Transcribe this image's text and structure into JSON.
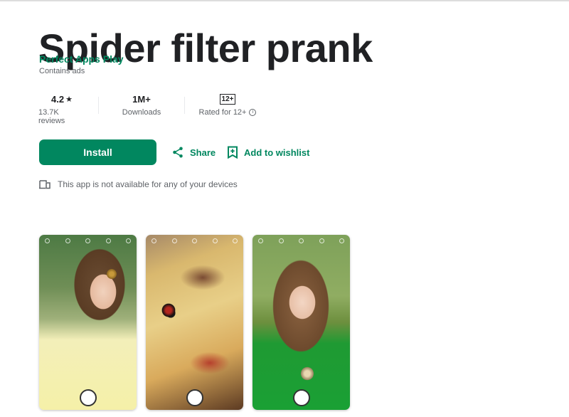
{
  "app": {
    "title": "Spider filter prank",
    "developer": "Perfect Apps Play",
    "ads_notice": "Contains ads"
  },
  "stats": [
    {
      "value": "4.2",
      "value_icon": "star-icon",
      "label": "13.7K reviews"
    },
    {
      "value": "1M+",
      "label": "Downloads"
    },
    {
      "value": "12+",
      "label": "Rated for 12+",
      "label_icon": "info-icon"
    }
  ],
  "actions": {
    "install_label": "Install",
    "share_label": "Share",
    "wishlist_label": "Add to wishlist"
  },
  "availability": {
    "icon": "devices-icon",
    "message": "This app is not available for any of your devices"
  },
  "screenshots": [
    {
      "subject": "Woman with spider on forehead"
    },
    {
      "subject": "Pizza with black widow spider"
    },
    {
      "subject": "Woman in green top with spider on chest"
    }
  ],
  "colors": {
    "accent": "#01875f",
    "text_primary": "#202124",
    "text_secondary": "#5f6368"
  }
}
